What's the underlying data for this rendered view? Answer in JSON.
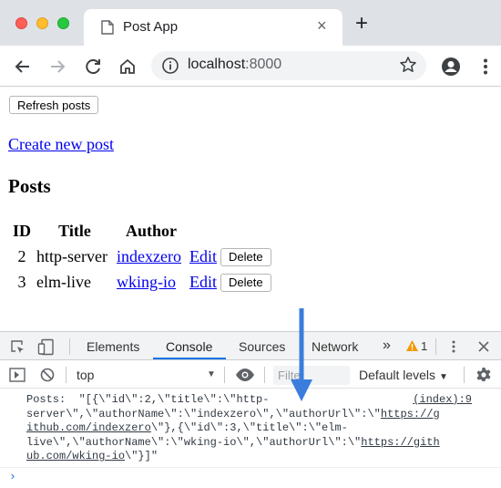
{
  "window": {
    "tab_title": "Post App",
    "new_tab_glyph": "+",
    "close_glyph": "×"
  },
  "toolbar": {
    "url_host": "localhost",
    "url_port": ":8000",
    "icons": [
      "back-icon",
      "forward-icon",
      "reload-icon",
      "home-icon",
      "info-icon",
      "star-icon",
      "profile-icon",
      "menu-icon"
    ]
  },
  "page": {
    "refresh_label": "Refresh posts",
    "create_link": "Create new post",
    "heading": "Posts",
    "columns": [
      "ID",
      "Title",
      "Author"
    ],
    "rows": [
      {
        "id": "2",
        "title": "http-server",
        "author": "indexzero",
        "edit": "Edit",
        "delete": "Delete"
      },
      {
        "id": "3",
        "title": "elm-live",
        "author": "wking-io",
        "edit": "Edit",
        "delete": "Delete"
      }
    ]
  },
  "devtools": {
    "tabs": [
      "Elements",
      "Console",
      "Sources",
      "Network"
    ],
    "active_tab": "Console",
    "overflow": "»",
    "warning_count": "1",
    "context": "top",
    "filter_placeholder": "Filter",
    "levels": "Default levels",
    "levels_caret": "▼",
    "log": {
      "source": "(index):9",
      "line1": "Posts:  \"[{\\\"id\\\":2,\\\"title\\\":\\\"http-",
      "line2a": "server\\\",\\\"authorName\\\":\\\"indexzero\\\",\\\"authorUrl\\\":\\\"",
      "line2_link": "https://g",
      "line3_link": "ithub.com/indexzero",
      "line3b": "\\\"},{\\\"id\\\":3,\\\"title\\\":\\\"elm-",
      "line4a": "live\\\",\\\"authorName\\\":\\\"wking-io\\\",\\\"authorUrl\\\":\\\"",
      "line4_link": "https://gith",
      "line5_link": "ub.com/wking-io",
      "line5b": "\\\"}]\""
    },
    "prompt": "›"
  },
  "colors": {
    "accent": "#1a73e8",
    "link": "#0000ee",
    "warning": "#f29900"
  }
}
